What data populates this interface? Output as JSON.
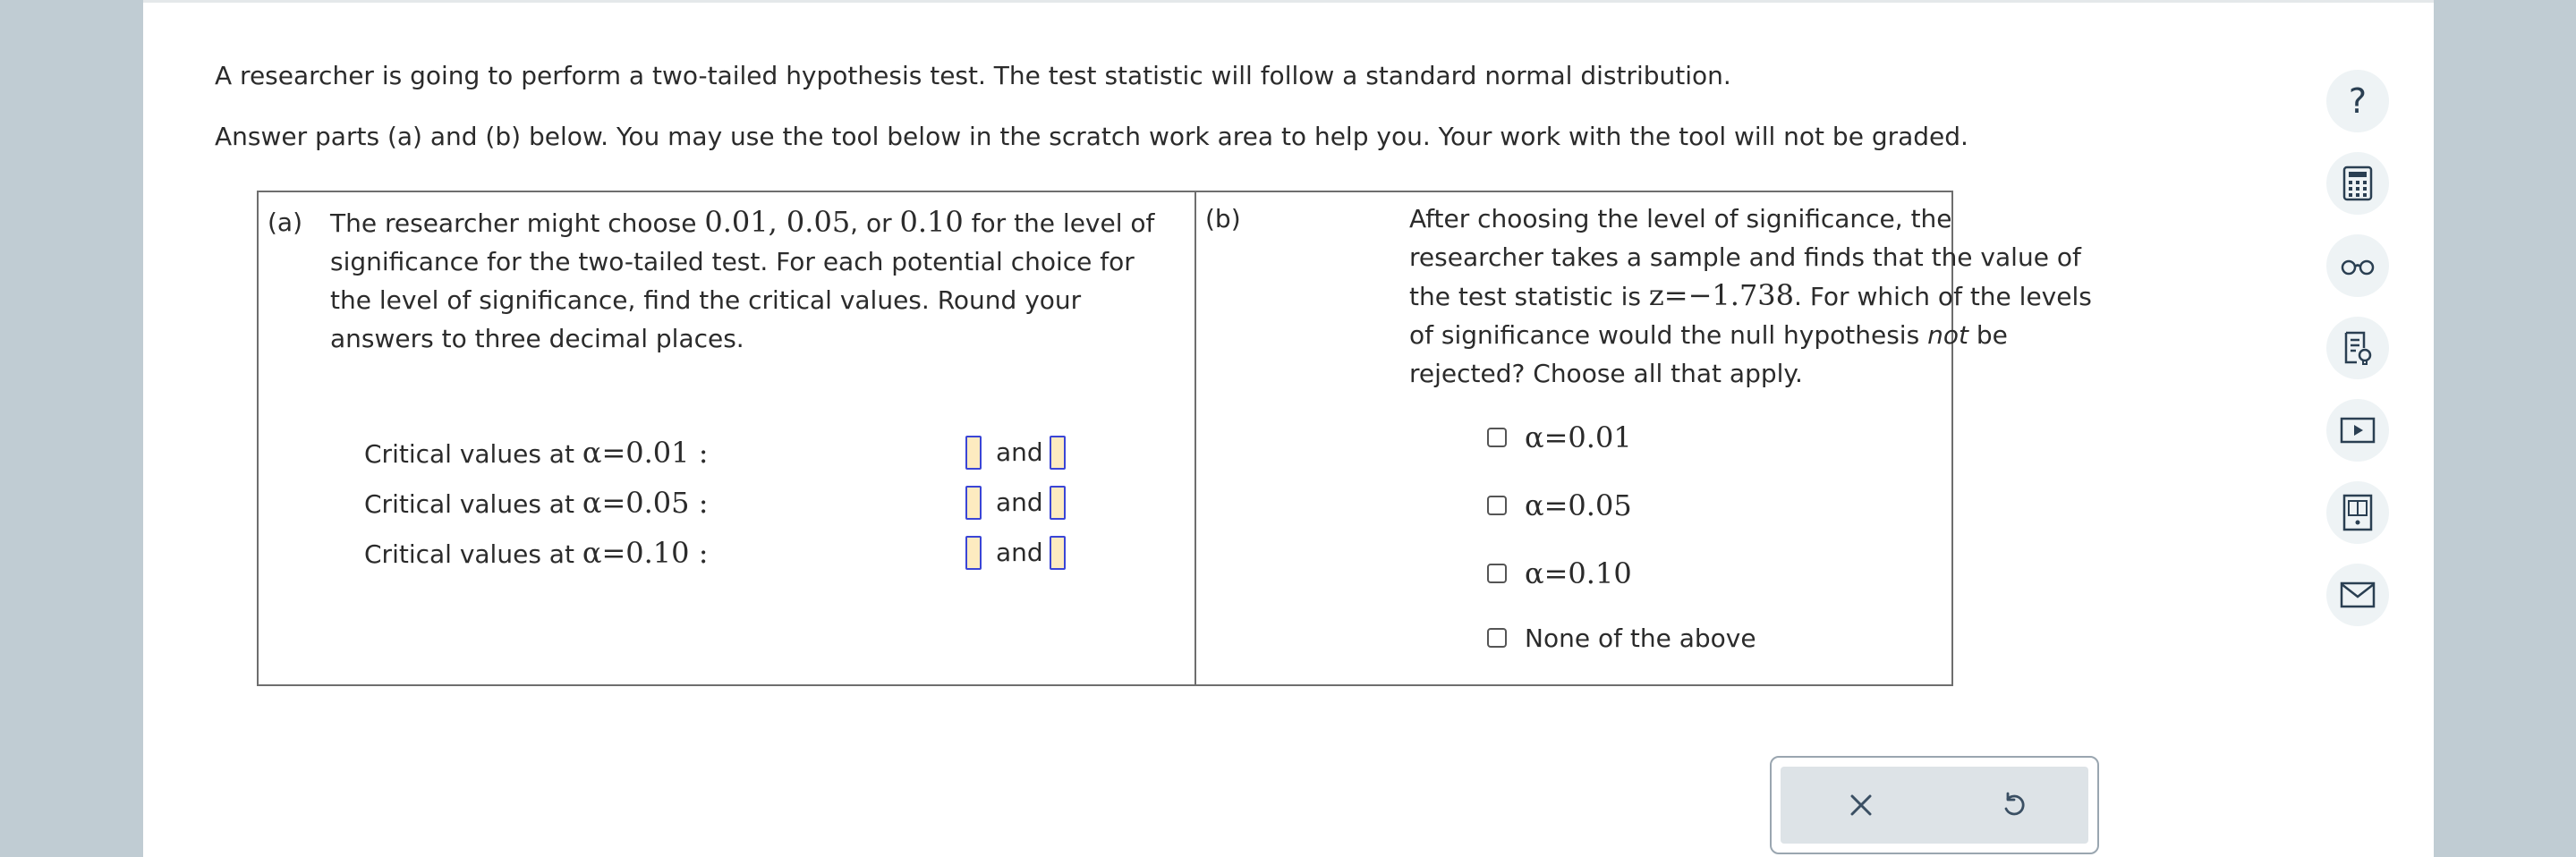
{
  "intro": {
    "line1": "A researcher is going to perform a two-tailed hypothesis test. The test statistic will follow a standard normal distribution.",
    "line2": "Answer parts (a) and (b) below. You may use the tool below in the scratch work area to help you. Your work with the tool will not be graded."
  },
  "part_a": {
    "label": "(a)",
    "l1_pre": "The researcher might choose ",
    "v1": "0.01",
    "comma1": ", ",
    "v2": "0.05",
    "or": ", or ",
    "v3": "0.10",
    "l1_post": " for the level of",
    "line2": "significance for the two-tailed test. For each potential choice for",
    "line3": "the level of significance, find the critical values. Round your",
    "line4": "answers to three decimal places.",
    "rows": [
      {
        "prefix": "Critical values at ",
        "alpha_expr": "α=0.01",
        "colon": " :",
        "and": "and"
      },
      {
        "prefix": "Critical values at ",
        "alpha_expr": "α=0.05",
        "colon": " :",
        "and": "and"
      },
      {
        "prefix": "Critical values at ",
        "alpha_expr": "α=0.10",
        "colon": " :",
        "and": "and"
      }
    ]
  },
  "part_b": {
    "label": "(b)",
    "line1": "After choosing the level of significance, the",
    "line2": "researcher takes a sample and finds that the value of",
    "line3_pre": "the test statistic is ",
    "z_expr": "z=−1.738",
    "line3_post": ". For which of the levels",
    "line4_pre": "of significance would the null hypothesis ",
    "line4_em": "not",
    "line4_post": " be",
    "line5": "rejected? Choose all that apply.",
    "options": [
      "α=0.01",
      "α=0.05",
      "α=0.10",
      "None of the above"
    ]
  },
  "tools": [
    "help-icon",
    "calculator-icon",
    "glasses-icon",
    "notes-icon",
    "video-icon",
    "textbook-icon",
    "mail-icon"
  ],
  "help_glyph": "?",
  "colors": {
    "background": "#c0ccd3",
    "input_fill": "#fdebc0",
    "input_border": "#3a45d6",
    "icon": "#2a3f52"
  }
}
